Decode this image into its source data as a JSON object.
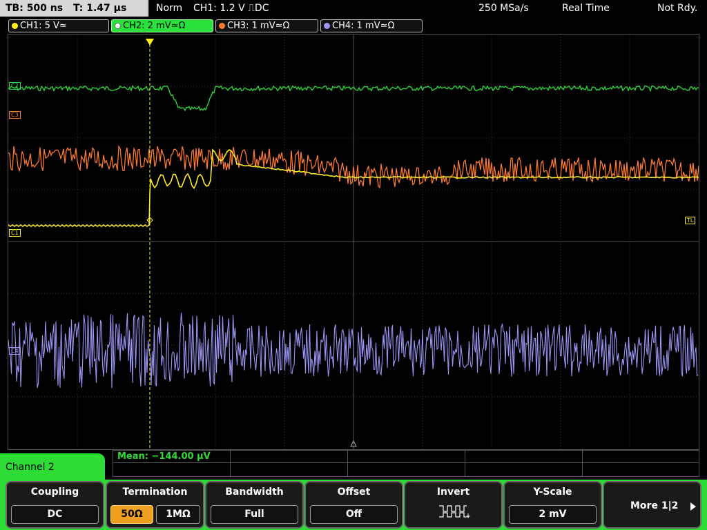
{
  "topbar": {
    "timebase": "TB: 500 ns",
    "trigger_time": "T: 1.47 µs",
    "mode": "Norm",
    "trigger_info": "CH1: 1.2 V ⎍DC",
    "sample_rate": "250 MSa/s",
    "acq_mode": "Real Time",
    "status": "Not Rdy."
  },
  "channels": [
    {
      "label": "CH1: 5 V≃",
      "color": "#ffee22"
    },
    {
      "label": "CH2: 2 mV≃Ω",
      "color": "#29e03c"
    },
    {
      "label": "CH3: 1 mV≃Ω",
      "color": "#ff7a2a"
    },
    {
      "label": "CH4: 1 mV≃Ω",
      "color": "#9b96f5"
    }
  ],
  "markers": {
    "c2": "C2",
    "c3": "C3",
    "c1": "C1",
    "c4": "C4",
    "tl": "TL"
  },
  "measurement": {
    "mean": "Mean: −144.00 µV"
  },
  "panel": {
    "channel_label": "Channel 2"
  },
  "softkeys": {
    "coupling": {
      "title": "Coupling",
      "value": "DC"
    },
    "termination": {
      "title": "Termination",
      "opt1": "50Ω",
      "opt2": "1MΩ"
    },
    "bandwidth": {
      "title": "Bandwidth",
      "value": "Full"
    },
    "offset": {
      "title": "Offset",
      "value": "Off"
    },
    "invert": {
      "title": "Invert"
    },
    "yscale": {
      "title": "Y-Scale",
      "value": "2 mV"
    },
    "more": {
      "title": "More 1|2"
    }
  },
  "colors": {
    "ch1": "#ffee22",
    "ch2": "#29e03c",
    "ch3": "#ff7a2a",
    "ch4": "#9b96f5",
    "softkey_bar": "#2ddc35"
  }
}
